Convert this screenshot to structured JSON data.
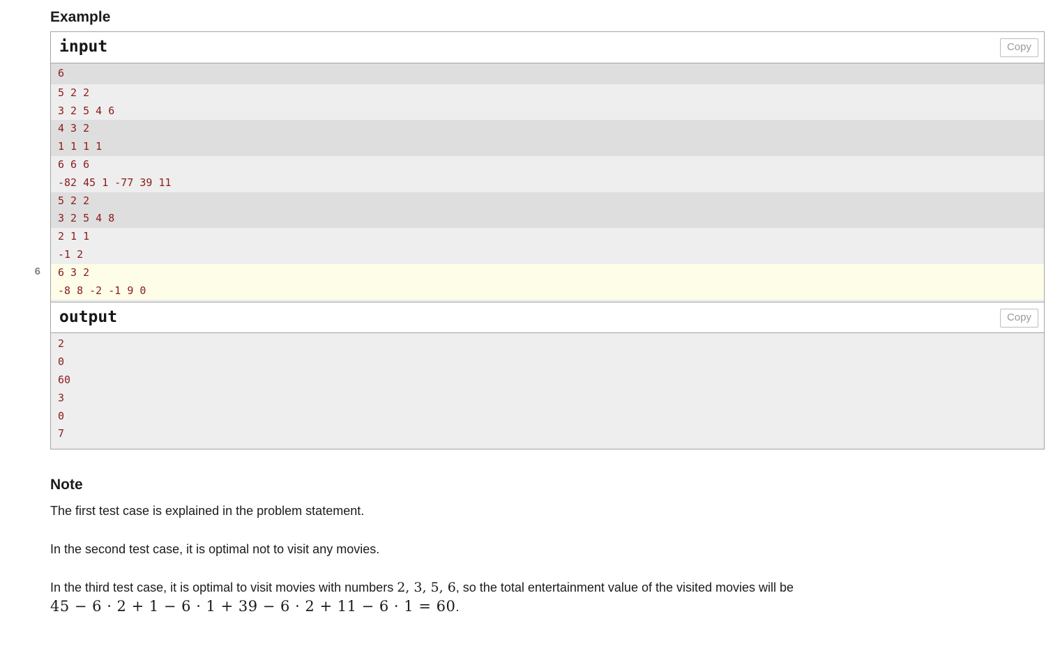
{
  "headings": {
    "example": "Example",
    "note": "Note"
  },
  "example": {
    "input": {
      "label": "input",
      "copy_label": "Copy",
      "groups": [
        {
          "shade": "shade-a",
          "lines": [
            "6"
          ]
        },
        {
          "shade": "shade-b",
          "lines": [
            "5 2 2",
            "3 2 5 4 6"
          ]
        },
        {
          "shade": "shade-a",
          "lines": [
            "4 3 2",
            "1 1 1 1"
          ]
        },
        {
          "shade": "shade-b",
          "lines": [
            "6 6 6",
            "-82 45 1 -77 39 11"
          ]
        },
        {
          "shade": "shade-a",
          "lines": [
            "5 2 2",
            "3 2 5 4 8"
          ]
        },
        {
          "shade": "shade-b",
          "lines": [
            "2 1 1",
            "-1 2"
          ]
        },
        {
          "shade": "shade-hl",
          "lines": [
            "6 3 2",
            "-8 8 -2 -1 9 0"
          ]
        }
      ],
      "gutter_marker": "6"
    },
    "output": {
      "label": "output",
      "copy_label": "Copy",
      "lines": [
        "2",
        "0",
        "60",
        "3",
        "0",
        "7"
      ]
    }
  },
  "note": {
    "paragraph_1": "The first test case is explained in the problem statement.",
    "paragraph_2": "In the second test case, it is optimal not to visit any movies.",
    "paragraph_3_pre": "In the third test case, it is optimal to visit movies with numbers ",
    "paragraph_3_numbers": "2, 3, 5, 6",
    "paragraph_3_post": ", so the total entertainment value of the visited movies will be",
    "paragraph_3_formula": "45 − 6 · 2 + 1 − 6 · 1 + 39 − 6 · 2 + 11 − 6 · 1 = 60",
    "paragraph_3_period": "."
  },
  "colors": {
    "code_text": "#8b1a1a",
    "shade_a": "#dedede",
    "shade_b": "#eeeeee",
    "shade_highlight": "#fdfde8",
    "border": "#a3a3a3",
    "copy_text": "#9a9a9a"
  }
}
